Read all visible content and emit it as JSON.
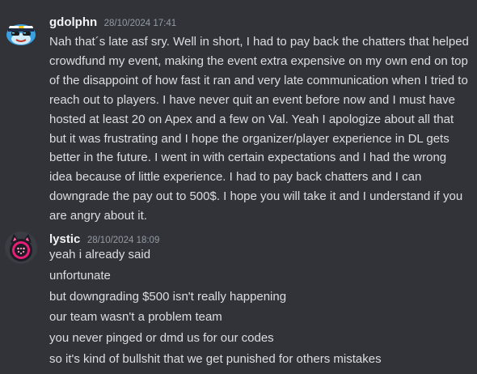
{
  "messages": [
    {
      "username": "gdolphn",
      "timestamp": "28/10/2024 17:41",
      "avatar_icon": "dolphin-cap-icon",
      "text": "Nah that´s late asf sry. Well in short, I had to pay back the chatters that helped crowdfund my event, making the event extra expensive on my own end on top of the disappoint of how fast it ran and very late communication when I tried to reach out to players. I have never quit an event before now and I must have hosted at least 20 on Apex and a few on Val. Yeah I apologize about all that but it was frustrating and I hope the organizer/player experience in DL gets better in the future. I went in with certain expectations and I had the wrong idea because of little experience. I had to pay back chatters and I can downgrade the pay out to 500$. I hope you will take it and I understand if you are angry about it."
    },
    {
      "username": "lystic",
      "timestamp": "28/10/2024 18:09",
      "avatar_icon": "pink-cat-robot-icon",
      "lines": [
        "yeah i already said",
        "unfortunate",
        "but downgrading $500 isn't really happening",
        "our team wasn't a problem team",
        "you never pinged or dmd us for our codes",
        "so it's kind of bullshit that we get punished for others mistakes"
      ]
    }
  ],
  "colors": {
    "background": "#313338",
    "text": "#dbdee1",
    "username": "#f2f3f5",
    "timestamp": "#949ba4"
  }
}
